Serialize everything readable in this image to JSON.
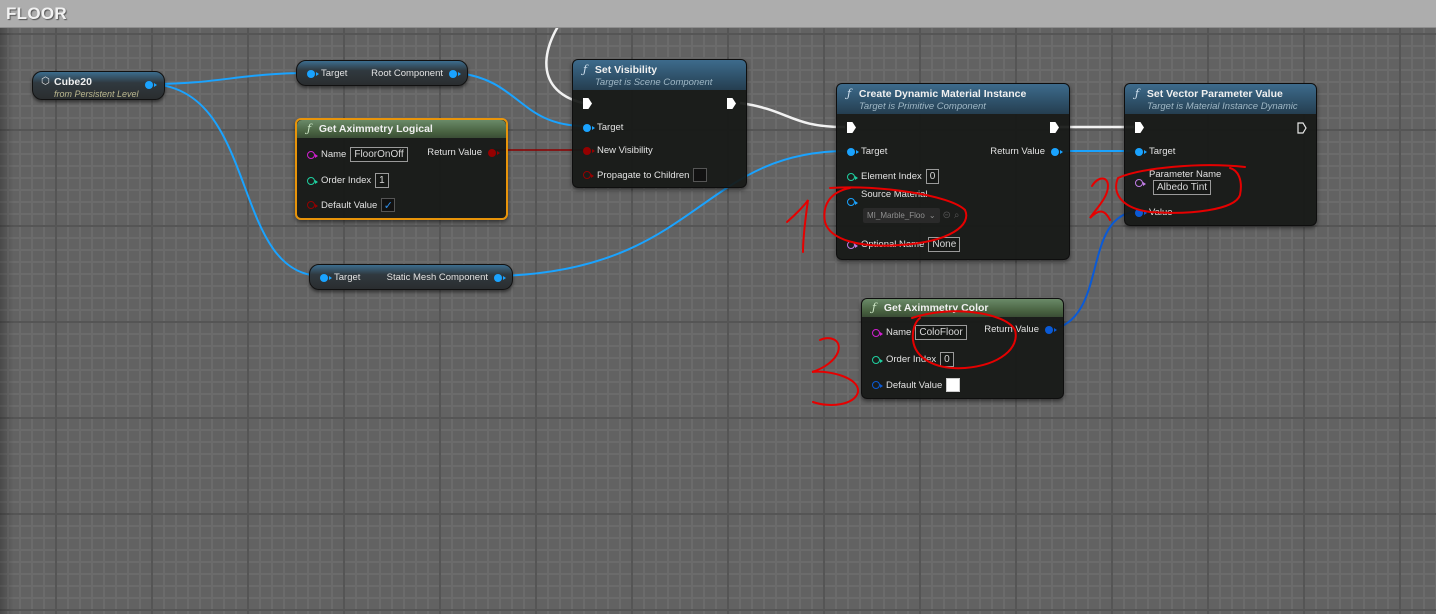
{
  "window": {
    "title": "FLOOR"
  },
  "colors": {
    "object_pin": "#1aa3ff",
    "bool_pin": "#950000",
    "name_pin": "#d11fd1",
    "int_pin": "#1fd0a0",
    "string_pin": "#d11fd1",
    "struct_pin": "#0a5ad6",
    "text_pin": "#c27de8",
    "annotation": "#e60000"
  },
  "nodes": {
    "cube20": {
      "title": "Cube20",
      "subtitle": "from Persistent Level",
      "icon": "cube-icon"
    },
    "get_root_component": {
      "input": "Target",
      "output": "Root Component"
    },
    "get_aximmetry_logical": {
      "title": "Get Aximmetry Logical",
      "icon": "function-icon",
      "name_label": "Name",
      "name_value": "FloorOnOff",
      "order_label": "Order Index",
      "order_value": "1",
      "default_label": "Default Value",
      "default_checked": true,
      "return_label": "Return Value"
    },
    "set_visibility": {
      "title": "Set Visibility",
      "subtitle": "Target is Scene Component",
      "target_label": "Target",
      "new_visibility_label": "New Visibility",
      "propagate_label": "Propagate to Children",
      "propagate_checked": false
    },
    "get_static_mesh": {
      "input": "Target",
      "output": "Static Mesh Component"
    },
    "create_dmi": {
      "title": "Create Dynamic Material Instance",
      "subtitle": "Target is Primitive Component",
      "target_label": "Target",
      "return_label": "Return Value",
      "element_index_label": "Element Index",
      "element_index_value": "0",
      "source_material_label": "Source Material",
      "source_material_value": "MI_Marble_Floo",
      "optional_name_label": "Optional Name",
      "optional_name_value": "None"
    },
    "set_vector_param": {
      "title": "Set Vector Parameter Value",
      "subtitle": "Target is Material Instance Dynamic",
      "target_label": "Target",
      "param_name_label": "Parameter Name",
      "param_name_value": "Albedo Tint",
      "value_label": "Value"
    },
    "get_aximmetry_color": {
      "title": "Get Aximmetry Color",
      "name_label": "Name",
      "name_value": "ColoFloor",
      "order_label": "Order Index",
      "order_value": "0",
      "default_label": "Default Value",
      "return_label": "Return Value"
    }
  },
  "annotations": [
    "1",
    "2",
    "3"
  ]
}
